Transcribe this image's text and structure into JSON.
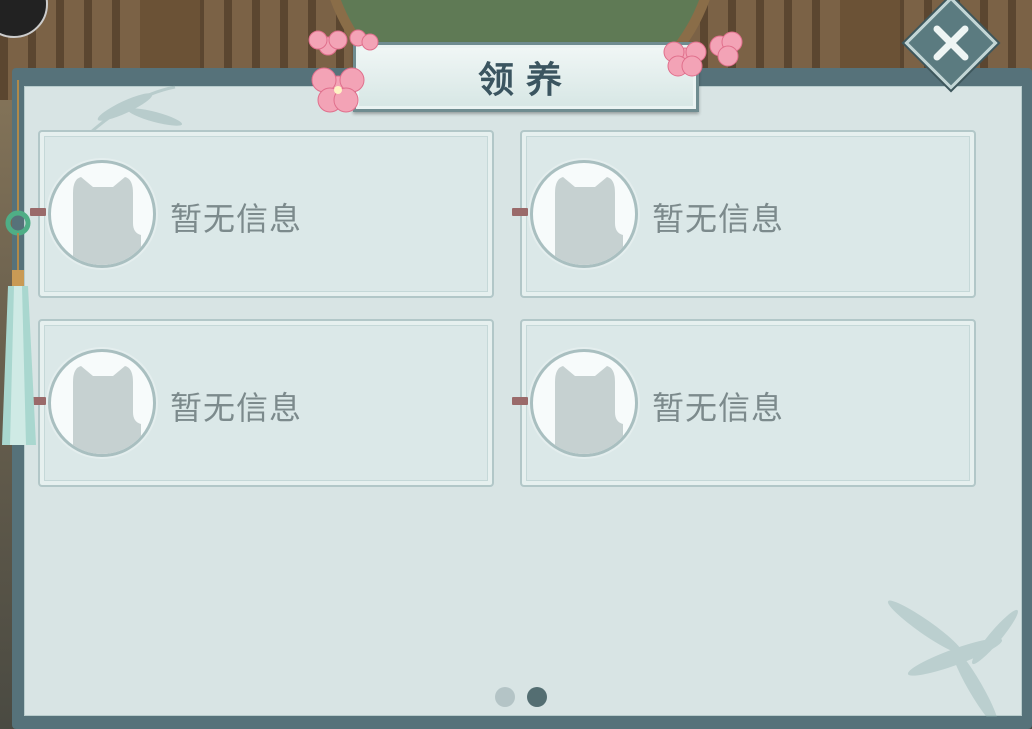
{
  "dialog": {
    "title": "领养",
    "close_icon": "close-x-icon"
  },
  "slots": [
    {
      "status": "暂无信息",
      "avatar_icon": "cat-silhouette-icon"
    },
    {
      "status": "暂无信息",
      "avatar_icon": "cat-silhouette-icon"
    },
    {
      "status": "暂无信息",
      "avatar_icon": "cat-silhouette-icon"
    },
    {
      "status": "暂无信息",
      "avatar_icon": "cat-silhouette-icon"
    }
  ],
  "pagination": {
    "pages": 2,
    "active_page": 2
  },
  "colors": {
    "panel_frame": "#56727a",
    "panel_bg": "#d8e4e4",
    "title_text": "#3b5560",
    "card_text": "#7c8a8c",
    "dot_inactive": "#b4c4c6",
    "dot_active": "#546e72"
  }
}
